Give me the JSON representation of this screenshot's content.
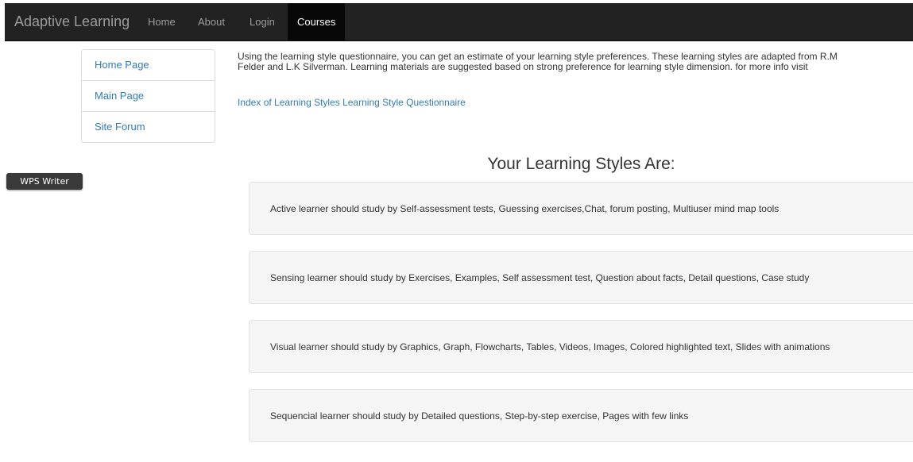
{
  "navbar": {
    "brand": "Adaptive Learning",
    "links": [
      "Home",
      "About",
      "Login",
      "Courses"
    ],
    "active": "Courses"
  },
  "sidebar": {
    "items": [
      {
        "label": "Home Page"
      },
      {
        "label": "Main Page"
      },
      {
        "label": "Site Forum"
      }
    ]
  },
  "overlay": {
    "wps_label": "WPS Writer"
  },
  "intro": {
    "text": "Using the learning style questionnaire, you can get an estimate of your learning style preferences. These learning styles are adapted from R.M Felder and L.K Silverman. Learning materials are suggested based on strong preference for learning style dimension. for more info visit",
    "link_label": "Index of Learning Styles Learning Style Questionnaire"
  },
  "results": {
    "heading": "Your Learning Styles Are:",
    "styles": [
      "Active learner should study by Self-assessment tests, Guessing exercises,Chat, forum posting, Multiuser mind map tools",
      "Sensing learner should study by Exercises, Examples, Self assessment test, Question about facts, Detail questions, Case study",
      "Visual learner should study by Graphics, Graph, Flowcharts, Tables, Videos, Images, Colored highlighted text, Slides with animations",
      "Sequencial learner should study by Detailed questions, Step-by-step exercise, Pages with few links"
    ]
  },
  "colors": {
    "navbar_bg": "#222222",
    "active_nav_bg": "#080808",
    "link": "#337ab7",
    "card_bg": "#f5f5f5"
  }
}
